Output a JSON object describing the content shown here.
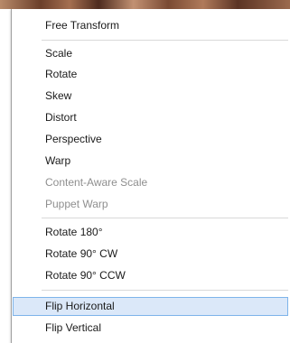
{
  "menu": {
    "items": [
      {
        "label": "Free Transform"
      },
      {
        "label": "Scale"
      },
      {
        "label": "Rotate"
      },
      {
        "label": "Skew"
      },
      {
        "label": "Distort"
      },
      {
        "label": "Perspective"
      },
      {
        "label": "Warp"
      },
      {
        "label": "Content-Aware Scale",
        "disabled": true
      },
      {
        "label": "Puppet Warp",
        "disabled": true
      },
      {
        "label": "Rotate 180°"
      },
      {
        "label": "Rotate 90° CW"
      },
      {
        "label": "Rotate 90° CCW"
      },
      {
        "label": "Flip Horizontal",
        "highlighted": true
      },
      {
        "label": "Flip Vertical"
      }
    ]
  },
  "colors": {
    "highlight_bg": "#dbe8f9",
    "highlight_border": "#7eb4ea",
    "disabled_text": "#8f8f8f"
  }
}
